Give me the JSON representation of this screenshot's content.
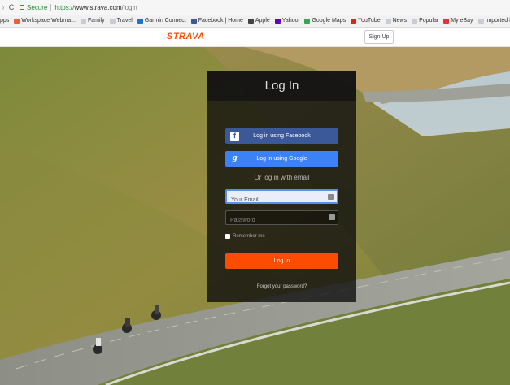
{
  "browser": {
    "secure_label": "Secure",
    "url_proto": "https://",
    "url_host": "www.strava.com",
    "url_path": "/login"
  },
  "bookmarks": [
    {
      "label": "pps",
      "icon": "apps-icon",
      "color": "#888888"
    },
    {
      "label": "Workspace Webma...",
      "icon": "workspace-icon",
      "color": "#e8603c"
    },
    {
      "label": "Family",
      "icon": "folder-icon",
      "color": "#c9ccd1"
    },
    {
      "label": "Travel",
      "icon": "folder-icon",
      "color": "#c9ccd1"
    },
    {
      "label": "Garmin Connect",
      "icon": "garmin-icon",
      "color": "#1a73c7"
    },
    {
      "label": "Facebook | Home",
      "icon": "facebook-icon",
      "color": "#3b5998"
    },
    {
      "label": "Apple",
      "icon": "apple-icon",
      "color": "#444444"
    },
    {
      "label": "Yahoo!",
      "icon": "yahoo-icon",
      "color": "#5f01d1"
    },
    {
      "label": "Google Maps",
      "icon": "maps-icon",
      "color": "#34a853"
    },
    {
      "label": "YouTube",
      "icon": "youtube-icon",
      "color": "#e62117"
    },
    {
      "label": "News",
      "icon": "folder-icon",
      "color": "#c9ccd1"
    },
    {
      "label": "Popular",
      "icon": "folder-icon",
      "color": "#c9ccd1"
    },
    {
      "label": "My eBay",
      "icon": "ebay-icon",
      "color": "#e53238"
    },
    {
      "label": "Imported From Safari",
      "icon": "folder-icon",
      "color": "#c9ccd1"
    },
    {
      "label": "Ma",
      "icon": "mail-icon",
      "color": "#1a73c7"
    }
  ],
  "header": {
    "logo": "STRAVA",
    "signup_label": "Sign Up"
  },
  "login": {
    "title": "Log In",
    "facebook_label": "Log in using Facebook",
    "google_label": "Log in using Google",
    "or_text": "Or log in with email",
    "email_placeholder": "Your Email",
    "password_placeholder": "Password",
    "remember_label": "Remember me",
    "login_label": "Log In",
    "forgot_label": "Forgot your password?"
  },
  "colors": {
    "brand": "#fc4c02",
    "facebook": "#3b5998",
    "google": "#3b82f6"
  }
}
